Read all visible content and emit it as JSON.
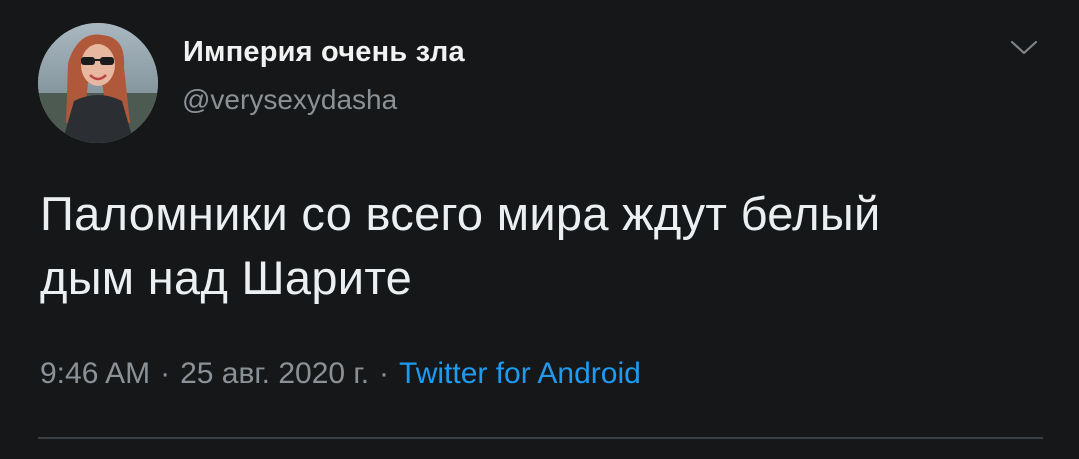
{
  "tweet": {
    "author": {
      "display_name": "Империя очень зла",
      "handle": "@verysexydasha",
      "avatar_icon": "profile-photo"
    },
    "text_line1": "Паломники со всего мира ждут белый",
    "text_line2": "дым над Шарите",
    "meta": {
      "time": "9:46 AM",
      "separator": "·",
      "date": "25 авг. 2020 г.",
      "source": "Twitter for Android"
    },
    "more_icon": "chevron-down-icon"
  },
  "colors": {
    "background": "#151718",
    "primary_text": "#eceff1",
    "secondary_text": "#8b9197",
    "link": "#1d9bf0"
  }
}
